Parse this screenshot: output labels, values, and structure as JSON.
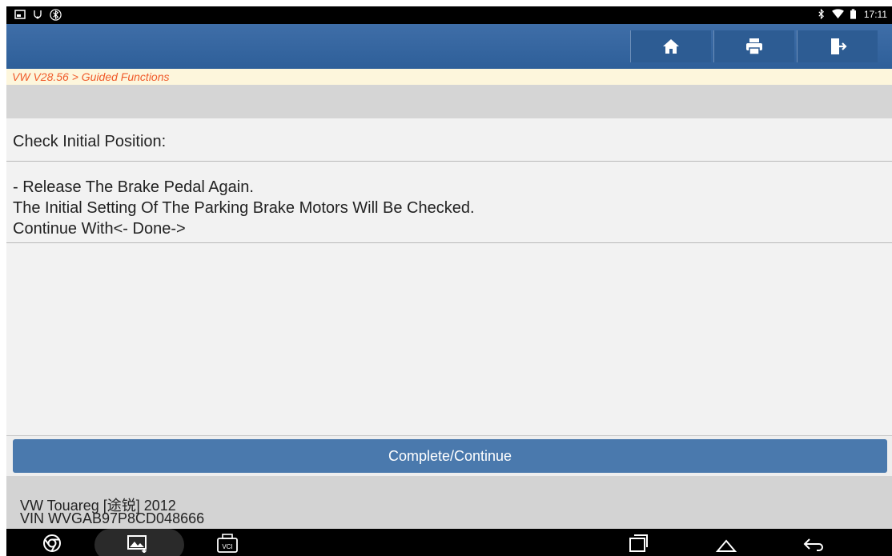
{
  "status_bar": {
    "time": "17:11"
  },
  "toolbar": {
    "home_icon": "home-icon",
    "print_icon": "printer-icon",
    "exit_icon": "exit-icon"
  },
  "breadcrumb": "VW V28.56 > Guided Functions",
  "step": {
    "title": "Check Initial Position:",
    "lines": [
      "- Release The Brake Pedal Again.",
      "The Initial Setting Of The Parking Brake Motors Will Be Checked.",
      "Continue With<- Done->"
    ]
  },
  "action_button": {
    "label": "Complete/Continue"
  },
  "vehicle": {
    "model": "VW Touareg [途锐] 2012",
    "vin": "VIN WVGAB97P8CD048666"
  },
  "nav_bar": {
    "vci_label": "VCI"
  }
}
